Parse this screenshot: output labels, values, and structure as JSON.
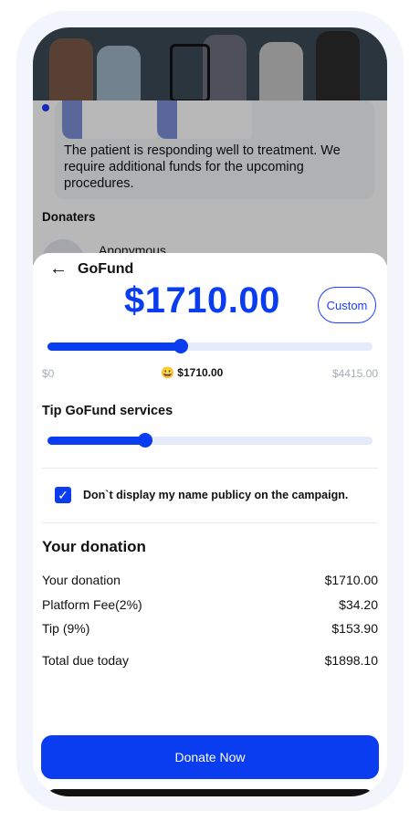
{
  "background": {
    "update_text": "The patient is responding well to treatment. We require additional funds for the upcoming procedures.",
    "donaters_heading": "Donaters",
    "donor_name": "Anonymous"
  },
  "sheet": {
    "back_icon": "←",
    "brand": "GoFund",
    "amount": "$1710.00",
    "custom_label": "Custom",
    "slider": {
      "min": "$0",
      "max": "$4415.00",
      "current_emoji": "😀",
      "current": "$1710.00",
      "fraction": 0.41
    },
    "tip_title": "Tip GoFund services",
    "tip_slider_fraction": 0.3,
    "anonymous_checkbox": {
      "checked": true,
      "label": "Don`t display my name publicy on the campaign."
    },
    "summary_title": "Your donation",
    "summary": [
      {
        "label": "Your donation",
        "value": "$1710.00"
      },
      {
        "label": "Platform Fee(2%)",
        "value": "$34.20"
      },
      {
        "label": "Tip (9%)",
        "value": "$153.90"
      }
    ],
    "total": {
      "label": "Total due today",
      "value": "$1898.10"
    },
    "donate_button": "Donate Now"
  },
  "colors": {
    "accent": "#0a3cf0",
    "track": "#e6ebfb"
  }
}
